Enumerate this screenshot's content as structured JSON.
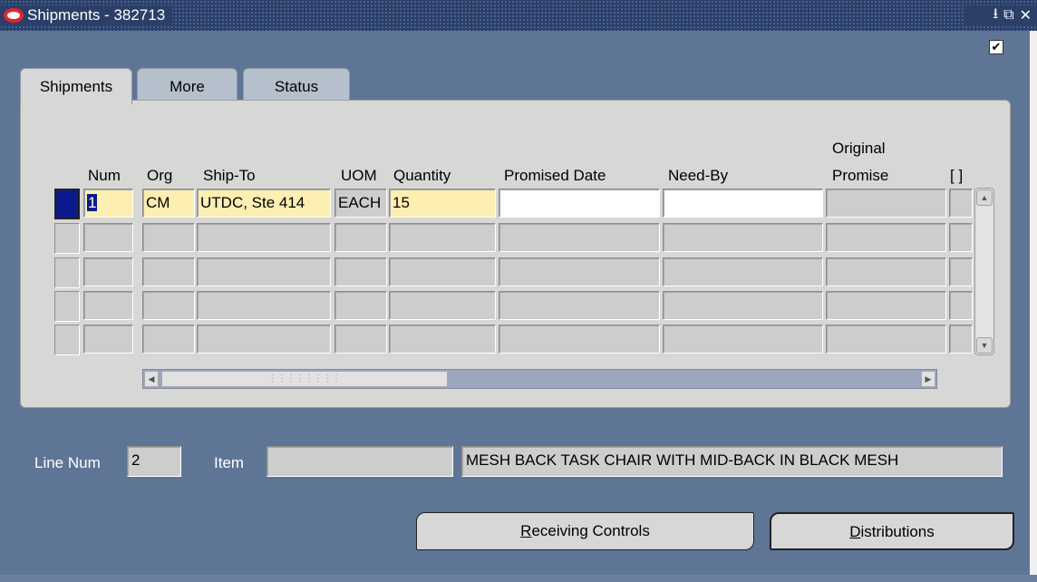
{
  "window": {
    "title": "Shipments - 382713",
    "controls": [
      "⭳",
      "⧉",
      "✕"
    ],
    "checkbox_checked": "✔"
  },
  "tabs": [
    {
      "label": "Shipments",
      "active": true
    },
    {
      "label": "More",
      "active": false
    },
    {
      "label": "Status",
      "active": false
    }
  ],
  "table": {
    "headers": {
      "num": "Num",
      "org": "Org",
      "ship_to": "Ship-To",
      "uom": "UOM",
      "quantity": "Quantity",
      "promised_date": "Promised Date",
      "need_by": "Need-By",
      "original_promise_1": "Original",
      "original_promise_2": "Promise",
      "brackets": "[ ]"
    },
    "rows": [
      {
        "num": "1",
        "org": "CM",
        "ship_to": "UTDC, Ste 414",
        "uom": "EACH",
        "quantity": "15",
        "promised_date": "",
        "need_by": "",
        "original_promise": ""
      },
      {
        "num": "",
        "org": "",
        "ship_to": "",
        "uom": "",
        "quantity": "",
        "promised_date": "",
        "need_by": "",
        "original_promise": ""
      },
      {
        "num": "",
        "org": "",
        "ship_to": "",
        "uom": "",
        "quantity": "",
        "promised_date": "",
        "need_by": "",
        "original_promise": ""
      },
      {
        "num": "",
        "org": "",
        "ship_to": "",
        "uom": "",
        "quantity": "",
        "promised_date": "",
        "need_by": "",
        "original_promise": ""
      },
      {
        "num": "",
        "org": "",
        "ship_to": "",
        "uom": "",
        "quantity": "",
        "promised_date": "",
        "need_by": "",
        "original_promise": ""
      }
    ]
  },
  "lower": {
    "line_num_label": "Line Num",
    "line_num_value": "2",
    "item_label": "Item",
    "item_value": "",
    "description": "MESH BACK TASK CHAIR WITH MID-BACK IN BLACK MESH"
  },
  "buttons": {
    "receiving_controls_first": "R",
    "receiving_controls_rest": "eceiving Controls",
    "distributions_first": "D",
    "distributions_rest": "istributions"
  },
  "colors": {
    "background": "#5f7596",
    "titlebar": "#2b3f68",
    "panel": "#d7d7d6",
    "required_field": "#fdeeb1",
    "current_record": "#0a1a8c"
  }
}
